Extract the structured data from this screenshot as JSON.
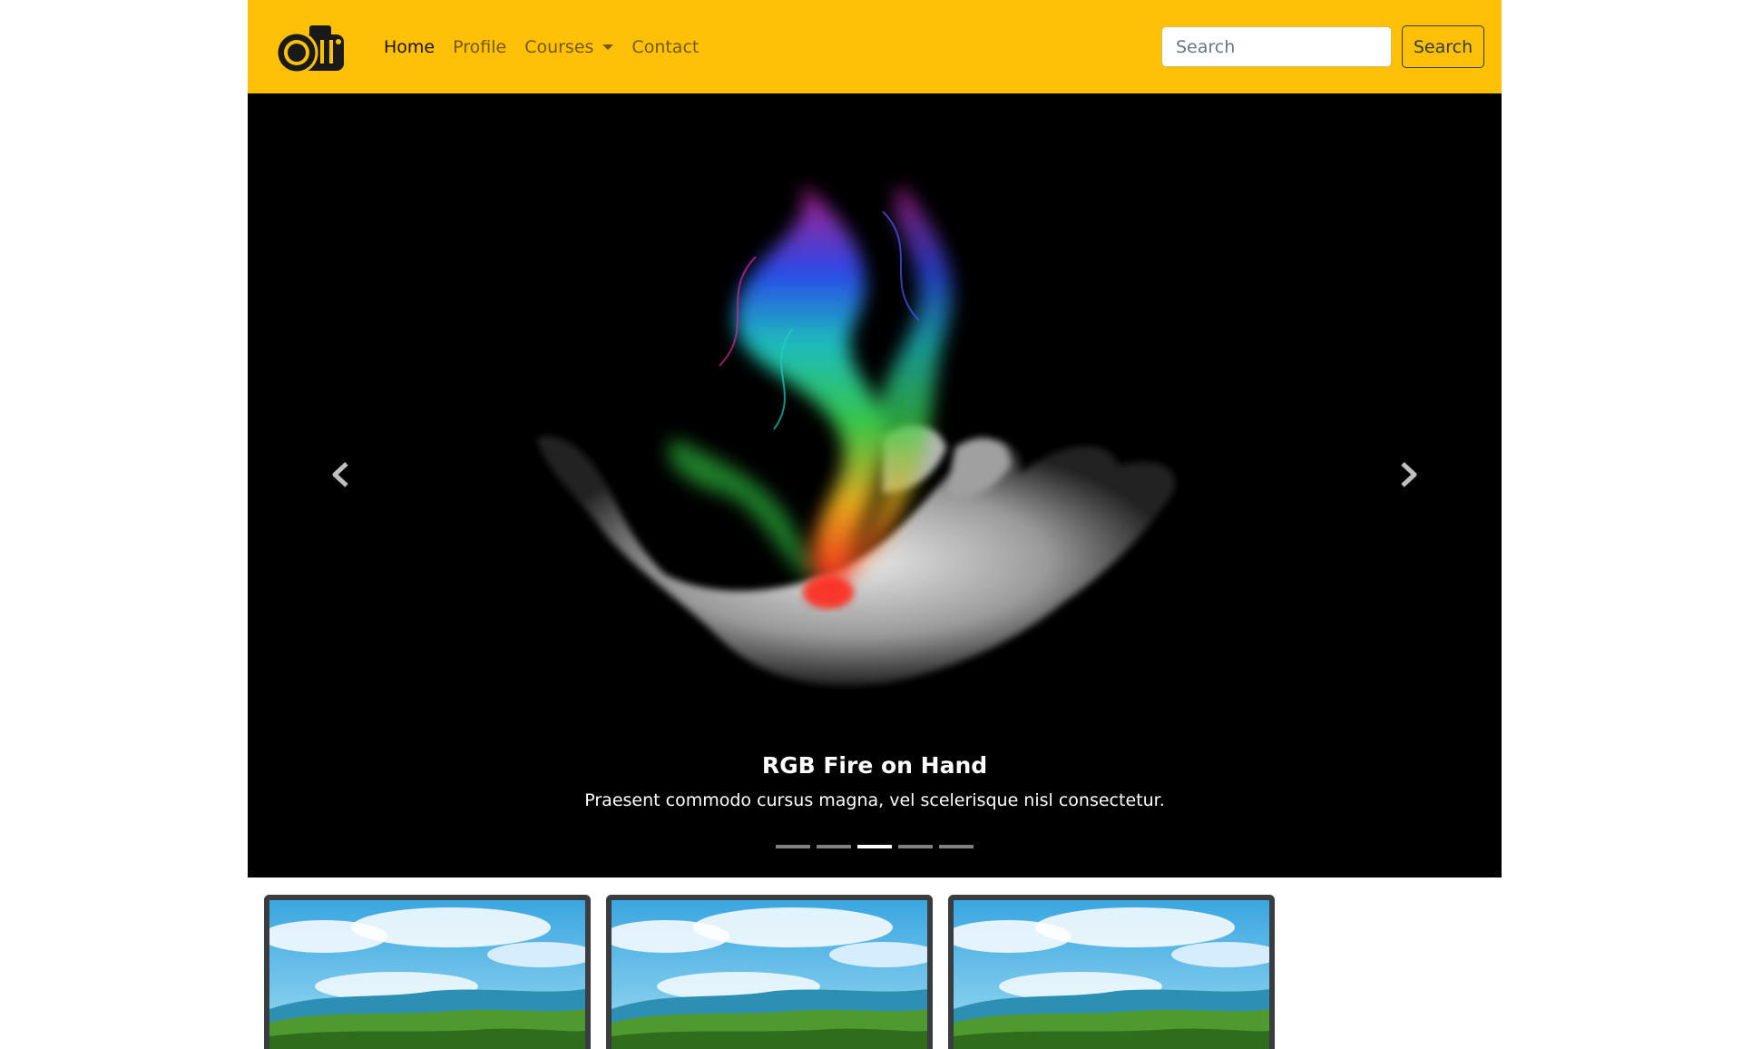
{
  "navbar": {
    "brand_icon": "camera-logo-icon",
    "links": [
      {
        "label": "Home",
        "active": true
      },
      {
        "label": "Profile",
        "active": false
      },
      {
        "label": "Courses",
        "active": false,
        "dropdown": true
      },
      {
        "label": "Contact",
        "active": false
      }
    ],
    "search": {
      "placeholder": "Search",
      "button_label": "Search"
    },
    "background": "#ffc107"
  },
  "carousel": {
    "slide_title": "RGB Fire on Hand",
    "slide_text": "Praesent commodo cursus magna, vel scelerisque nisl consectetur.",
    "indicator_count": 5,
    "active_index": 3,
    "prev_icon": "chevron-left-icon",
    "next_icon": "chevron-right-icon"
  },
  "thumbnails": [
    {
      "image": "landscape-sky-image"
    },
    {
      "image": "landscape-sky-image"
    },
    {
      "image": "landscape-sky-image"
    }
  ]
}
